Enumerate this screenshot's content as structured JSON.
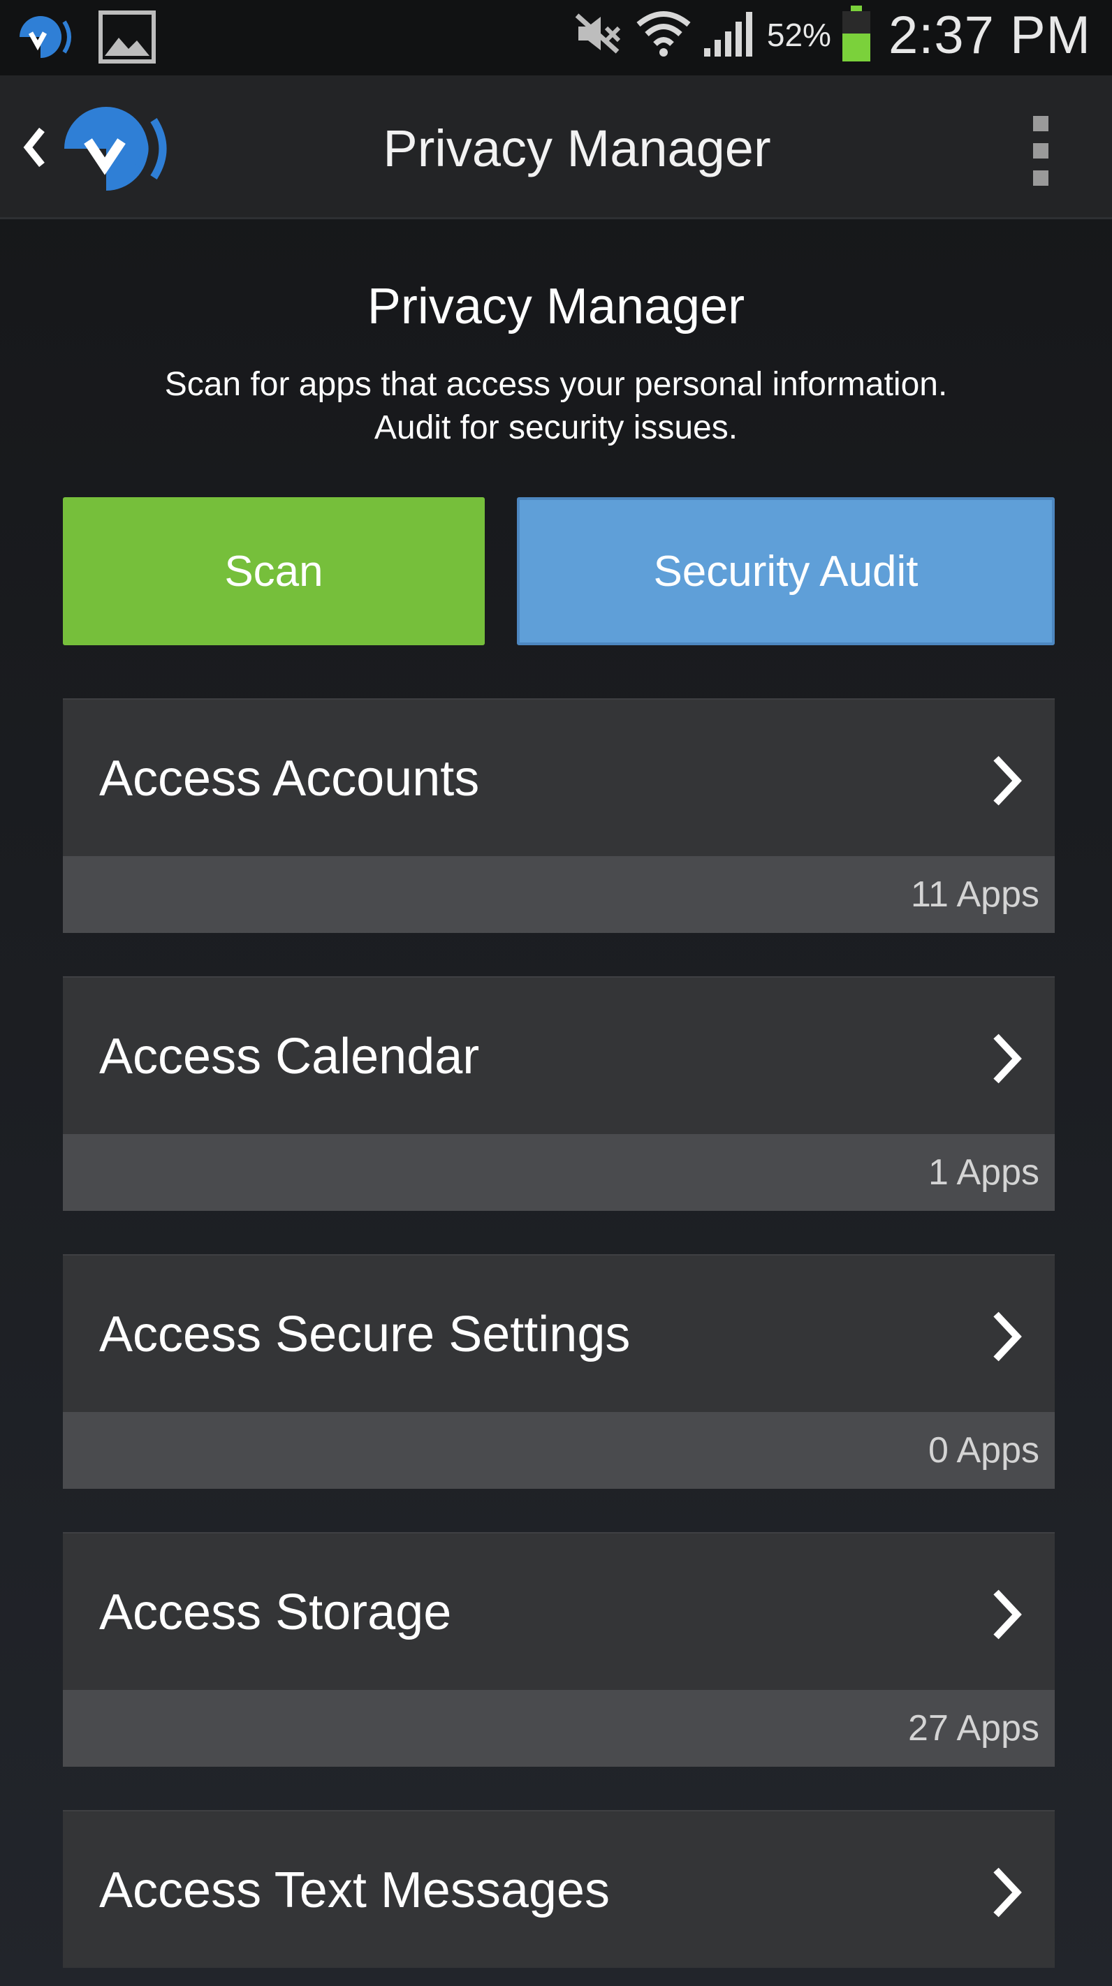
{
  "status_bar": {
    "icons": [
      "malwarebytes-icon",
      "gallery-icon",
      "mute-icon",
      "wifi-icon",
      "signal-icon",
      "battery-icon"
    ],
    "battery_percent": "52%",
    "time": "2:37 PM"
  },
  "action_bar": {
    "title": "Privacy Manager",
    "icons": [
      "back-chevron-icon",
      "app-logo-icon",
      "overflow-menu-icon"
    ]
  },
  "header": {
    "title": "Privacy Manager",
    "subtitle_line1": "Scan for apps that access your personal information.",
    "subtitle_line2": "Audit for security issues."
  },
  "buttons": {
    "scan_label": "Scan",
    "audit_label": "Security Audit"
  },
  "colors": {
    "scan_green": "#76bf3b",
    "audit_blue": "#5f9fd8",
    "logo_blue": "#2f7fd6",
    "card_bg": "#343537",
    "card_footer_bg": "#4a4b4e"
  },
  "categories": [
    {
      "label": "Access Accounts",
      "count": "11 Apps"
    },
    {
      "label": "Access Calendar",
      "count": "1 Apps"
    },
    {
      "label": "Access Secure Settings",
      "count": "0 Apps"
    },
    {
      "label": "Access Storage",
      "count": "27 Apps"
    },
    {
      "label": "Access Text Messages",
      "count": ""
    }
  ]
}
